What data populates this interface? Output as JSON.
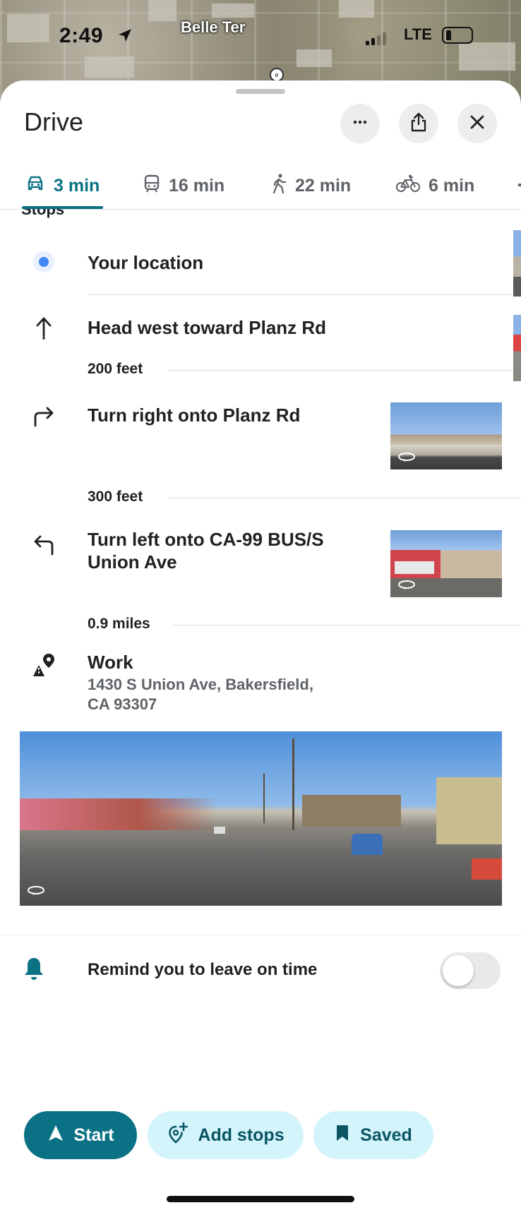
{
  "status_bar": {
    "time": "2:49",
    "network": "LTE"
  },
  "map": {
    "label": "Belle Ter"
  },
  "header": {
    "title": "Drive"
  },
  "tabs": [
    {
      "label": "3 min",
      "mode": "car-icon",
      "active": true
    },
    {
      "label": "16 min",
      "mode": "transit-icon",
      "active": false
    },
    {
      "label": "22 min",
      "mode": "walk-icon",
      "active": false
    },
    {
      "label": "6 min",
      "mode": "bike-icon",
      "active": false
    }
  ],
  "section": {
    "clipped_label": "Stops"
  },
  "steps": [
    {
      "text": "Your location",
      "icon": "current-location-icon"
    },
    {
      "text": "Head west toward Planz Rd",
      "icon": "arrow-up-icon",
      "distance_after": "200 feet"
    },
    {
      "text": "Turn right onto Planz Rd",
      "icon": "turn-right-icon",
      "distance_after": "300 feet"
    },
    {
      "text": "Turn left onto CA-99 BUS/S",
      "text_line2": "Union Ave",
      "icon": "turn-left-icon",
      "distance_after": "0.9 miles"
    },
    {
      "text": "Work",
      "address_line1": "1430 S Union Ave, Bakersfield,",
      "address_line2": "CA 93307",
      "icon": "destination-icon"
    }
  ],
  "reminder": {
    "label": "Remind you to leave on time",
    "enabled": false
  },
  "actions": {
    "start": "Start",
    "add_stops": "Add stops",
    "saved": "Saved"
  },
  "colors": {
    "accent": "#0b7285",
    "secondary_pill": "#d3f4fb",
    "location_dot": "#4285f4"
  }
}
